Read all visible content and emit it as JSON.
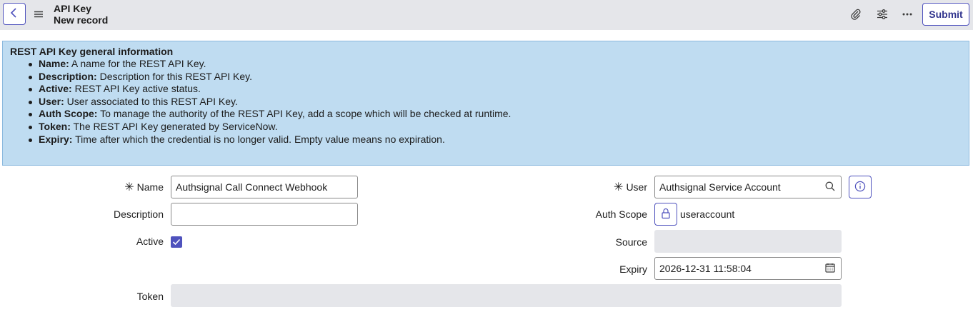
{
  "header": {
    "title": "API Key",
    "subtitle": "New record",
    "submit_label": "Submit"
  },
  "icons": {
    "back": "chevron-left-icon",
    "menu": "hamburger-icon",
    "attach": "paperclip-icon",
    "settings": "sliders-icon",
    "more": "ellipsis-icon",
    "search": "search-icon",
    "info": "info-icon",
    "lock": "lock-icon",
    "calendar": "calendar-icon"
  },
  "colors": {
    "accent": "#4f52bd",
    "info_bg": "#bfdcf1",
    "topbar_bg": "#e5e6ea"
  },
  "info": {
    "title": "REST API Key general information",
    "items": [
      {
        "term": "Name:",
        "text": " A name for the REST API Key."
      },
      {
        "term": "Description:",
        "text": " Description for this REST API Key."
      },
      {
        "term": "Active:",
        "text": " REST API Key active status."
      },
      {
        "term": "User:",
        "text": " User associated to this REST API Key."
      },
      {
        "term": "Auth Scope:",
        "text": " To manage the authority of the REST API Key, add a scope which will be checked at runtime."
      },
      {
        "term": "Token:",
        "text": " The REST API Key generated by ServiceNow."
      },
      {
        "term": "Expiry:",
        "text": " Time after which the credential is no longer valid. Empty value means no expiration."
      }
    ]
  },
  "form": {
    "name": {
      "label": "Name",
      "required_mark": "✳",
      "value": "Authsignal Call Connect Webhook"
    },
    "description": {
      "label": "Description",
      "value": ""
    },
    "active": {
      "label": "Active",
      "checked": true
    },
    "user": {
      "label": "User",
      "required_mark": "✳",
      "value": "Authsignal Service Account"
    },
    "auth_scope": {
      "label": "Auth Scope",
      "value": "useraccount"
    },
    "source": {
      "label": "Source",
      "value": ""
    },
    "expiry": {
      "label": "Expiry",
      "value": "2026-12-31 11:58:04"
    },
    "token": {
      "label": "Token",
      "value": ""
    }
  }
}
